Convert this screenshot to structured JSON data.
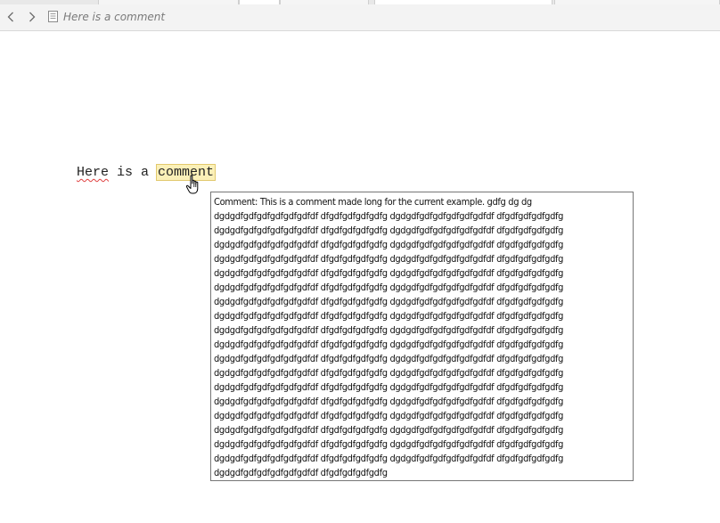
{
  "navbar": {
    "back_icon": "chevron-left-icon",
    "forward_icon": "chevron-right-icon",
    "document_icon": "document-icon",
    "breadcrumb": "Here is a comment"
  },
  "editor": {
    "word_here": "Here",
    "text_middle": " is a ",
    "commented_word": "comment"
  },
  "tooltip": {
    "lines": [
      "Comment: This is a comment made long for the current example. gdfg dg dg",
      "dgdgdfgdfgdfgdfgdfgdfdf dfgdfgdfgdfgdfg dgdgdfgdfgdfgdfgdfgdfdf dfgdfgdfgdfgdfg",
      "dgdgdfgdfgdfgdfgdfgdfdf dfgdfgdfgdfgdfg dgdgdfgdfgdfgdfgdfgdfdf dfgdfgdfgdfgdfg",
      "dgdgdfgdfgdfgdfgdfgdfdf dfgdfgdfgdfgdfg dgdgdfgdfgdfgdfgdfgdfdf dfgdfgdfgdfgdfg",
      "dgdgdfgdfgdfgdfgdfgdfdf dfgdfgdfgdfgdfg dgdgdfgdfgdfgdfgdfgdfdf dfgdfgdfgdfgdfg",
      "dgdgdfgdfgdfgdfgdfgdfdf dfgdfgdfgdfgdfg dgdgdfgdfgdfgdfgdfgdfdf dfgdfgdfgdfgdfg",
      "dgdgdfgdfgdfgdfgdfgdfdf dfgdfgdfgdfgdfg dgdgdfgdfgdfgdfgdfgdfdf dfgdfgdfgdfgdfg",
      "dgdgdfgdfgdfgdfgdfgdfdf dfgdfgdfgdfgdfg dgdgdfgdfgdfgdfgdfgdfdf dfgdfgdfgdfgdfg",
      "dgdgdfgdfgdfgdfgdfgdfdf dfgdfgdfgdfgdfg dgdgdfgdfgdfgdfgdfgdfdf dfgdfgdfgdfgdfg",
      "dgdgdfgdfgdfgdfgdfgdfdf dfgdfgdfgdfgdfg dgdgdfgdfgdfgdfgdfgdfdf dfgdfgdfgdfgdfg",
      "dgdgdfgdfgdfgdfgdfgdfdf dfgdfgdfgdfgdfg dgdgdfgdfgdfgdfgdfgdfdf dfgdfgdfgdfgdfg",
      "dgdgdfgdfgdfgdfgdfgdfdf dfgdfgdfgdfgdfg dgdgdfgdfgdfgdfgdfgdfdf dfgdfgdfgdfgdfg",
      "dgdgdfgdfgdfgdfgdfgdfdf dfgdfgdfgdfgdfg dgdgdfgdfgdfgdfgdfgdfdf dfgdfgdfgdfgdfg",
      "dgdgdfgdfgdfgdfgdfgdfdf dfgdfgdfgdfgdfg dgdgdfgdfgdfgdfgdfgdfdf dfgdfgdfgdfgdfg",
      "dgdgdfgdfgdfgdfgdfgdfdf dfgdfgdfgdfgdfg dgdgdfgdfgdfgdfgdfgdfdf dfgdfgdfgdfgdfg",
      "dgdgdfgdfgdfgdfgdfgdfdf dfgdfgdfgdfgdfg dgdgdfgdfgdfgdfgdfgdfdf dfgdfgdfgdfgdfg",
      "dgdgdfgdfgdfgdfgdfgdfdf dfgdfgdfgdfgdfg dgdgdfgdfgdfgdfgdfgdfdf dfgdfgdfgdfgdfg",
      "dgdgdfgdfgdfgdfgdfgdfdf dfgdfgdfgdfgdfg dgdgdfgdfgdfgdfgdfgdfdf dfgdfgdfgdfgdfg",
      "dgdgdfgdfgdfgdfgdfgdfdf dfgdfgdfgdfgdfg dgdgdfgdfgdfgdfgdfgdfdf dfgdfgdfgdfgdfg",
      "dgdgdfgdfgdfgdfgdfgdfdf dfgdfgdfgdfgdfg"
    ]
  },
  "colors": {
    "navbar_bg": "#f3f3f3",
    "breadcrumb_text": "#7a7a7a",
    "comment_highlight": "#fbf0b8",
    "comment_border": "#e2c96e",
    "spellcheck_underline": "#e04040",
    "tooltip_border": "#767676"
  }
}
